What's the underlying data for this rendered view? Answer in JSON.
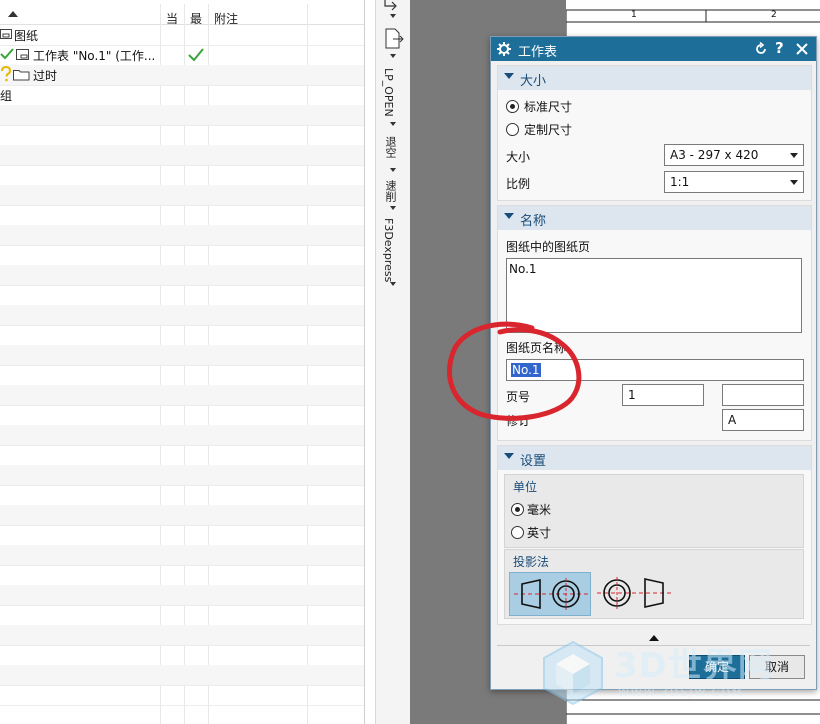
{
  "navigator": {
    "columns": {
      "current": "当",
      "latest": "最",
      "note": "附注"
    },
    "rows": [
      {
        "label": "图纸"
      },
      {
        "label": "工作表 \"No.1\" (工作..."
      },
      {
        "label": "过时"
      },
      {
        "label": "组"
      }
    ]
  },
  "vertical_toolbar": {
    "items": [
      "LP_OPEN",
      "退空",
      "速削",
      "F3Dexpress"
    ]
  },
  "dialog": {
    "title": "工作表",
    "size_section": {
      "header": "大小",
      "std_size_label": "标准尺寸",
      "custom_size_label": "定制尺寸",
      "size_label": "大小",
      "size_value": "A3 - 297 x 420",
      "scale_label": "比例",
      "scale_value": "1:1"
    },
    "name_section": {
      "header": "名称",
      "sheets_in_drawing_label": "图纸中的图纸页",
      "sheets_list": [
        "No.1"
      ],
      "sheet_name_label": "图纸页名称",
      "sheet_name_value": "No.1",
      "page_number_label": "页号",
      "page_number_value": "1",
      "page_extra_value": "",
      "revision_label": "修订",
      "revision_value": "A"
    },
    "settings_section": {
      "header": "设置",
      "units_label": "单位",
      "mm_label": "毫米",
      "inch_label": "英寸",
      "projection_label": "投影法"
    },
    "ok_label": "确定",
    "cancel_label": "取消"
  },
  "drawing_sheet": {
    "border_numbers": [
      "1",
      "2"
    ]
  },
  "watermark": {
    "brand": "3D世界网",
    "url": "WWW.3DSJW.COM"
  },
  "colors": {
    "dialog_title": "#1e6e9a",
    "section_header_text": "#1b4d7a",
    "selection": "#3366cc",
    "annotation_circle": "#d9262e",
    "check_green": "#3aa53a"
  }
}
